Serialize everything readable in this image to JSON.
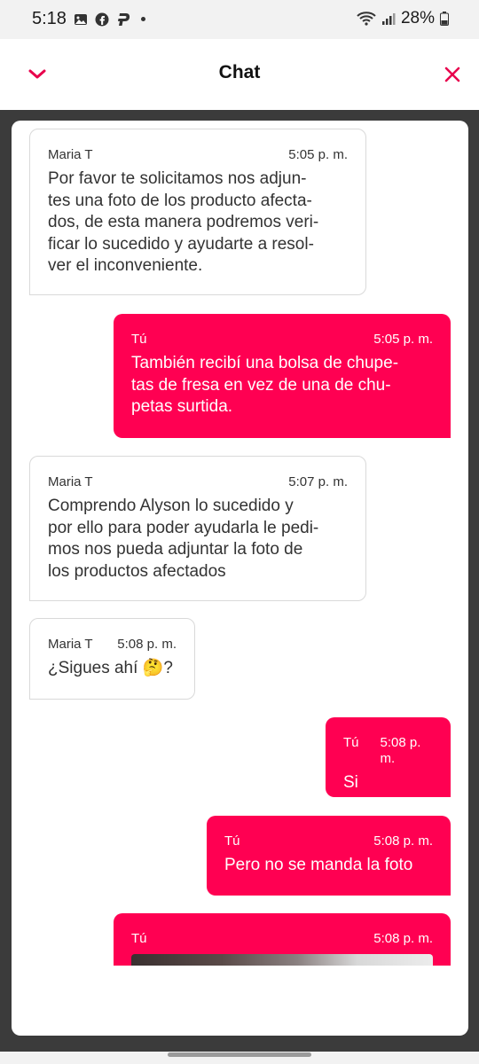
{
  "status_bar": {
    "time": "5:18",
    "battery": "28%"
  },
  "header": {
    "title": "Chat"
  },
  "colors": {
    "accent": "#ff0052",
    "backdrop": "#3b3b3b"
  },
  "messages": [
    {
      "sender": "Maria T",
      "time": "5:05 p. m.",
      "text": "Por favor te solicitamos nos adjun-\ntes una foto de los producto afecta-\ndos, de esta manera podremos veri-\nficar lo sucedido y ayudarte a resol-\nver el inconveniente."
    },
    {
      "sender": "Tú",
      "time": "5:05 p. m.",
      "text": "También recibí una bolsa de chupe-\ntas de fresa en vez de una de chu-\npetas surtida."
    },
    {
      "sender": "Maria T",
      "time": "5:07 p. m.",
      "text": "Comprendo Alyson lo sucedido y\npor ello para poder ayudarla le pedi-\nmos nos pueda adjuntar la foto de\nlos productos afectados"
    },
    {
      "sender": "Maria T",
      "time": "5:08 p. m.",
      "text": "¿Sigues ahí 🤔?"
    },
    {
      "sender": "Tú",
      "time": "5:08 p. m.",
      "text": "Si"
    },
    {
      "sender": "Tú",
      "time": "5:08 p. m.",
      "text": "Pero no se manda la foto"
    },
    {
      "sender": "Tú",
      "time": "5:08 p. m."
    }
  ]
}
